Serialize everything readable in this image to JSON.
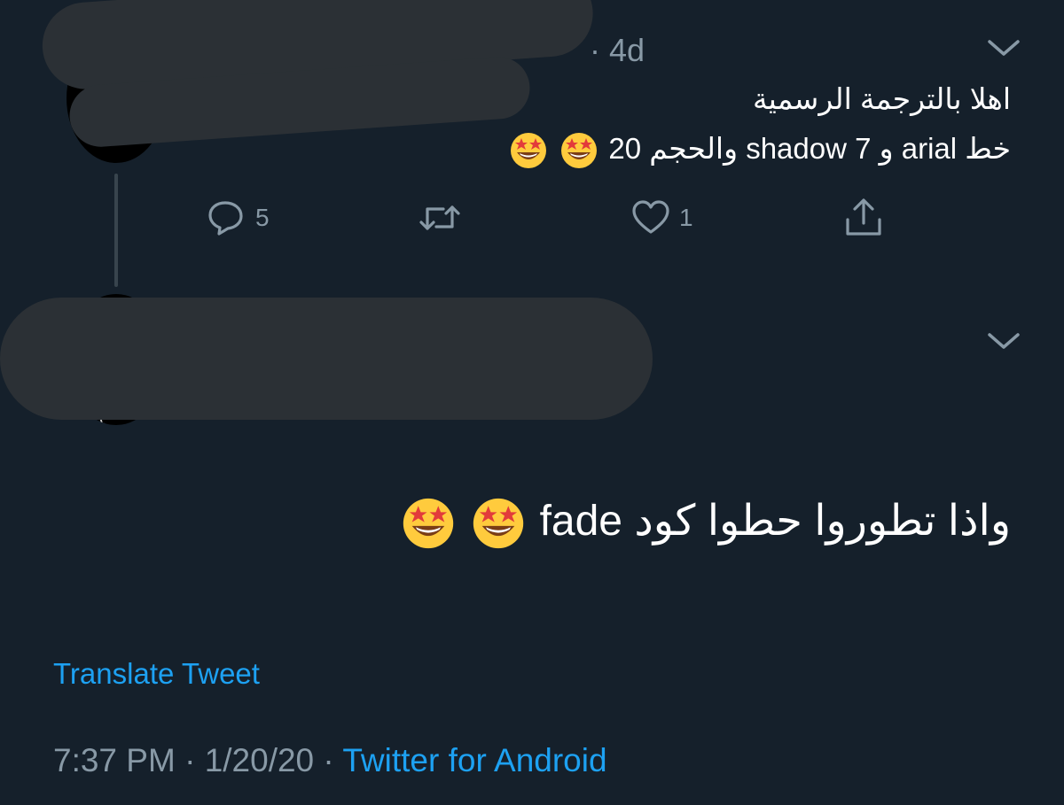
{
  "reply_tweet": {
    "time_separator": "·",
    "time_ago": "4d",
    "text_line1": "اهلا بالترجمة الرسمية",
    "text_line2": "خط arial و shadow 7 والحجم 20",
    "emojis": [
      "star-struck",
      "star-struck"
    ],
    "actions": {
      "reply_count": "5",
      "retweet_count": "",
      "like_count": "1"
    }
  },
  "main_tweet": {
    "text": "واذا تطوروا حطوا كود fade",
    "emojis": [
      "star-struck",
      "star-struck"
    ],
    "translate_label": "Translate Tweet",
    "time": "7:37 PM",
    "separator1": " · ",
    "date": "1/20/20",
    "separator2": " · ",
    "source": "Twitter for Android"
  },
  "colors": {
    "background": "#15202b",
    "muted": "#8899a6",
    "accent": "#1da1f2",
    "redaction": "#2b3035"
  }
}
